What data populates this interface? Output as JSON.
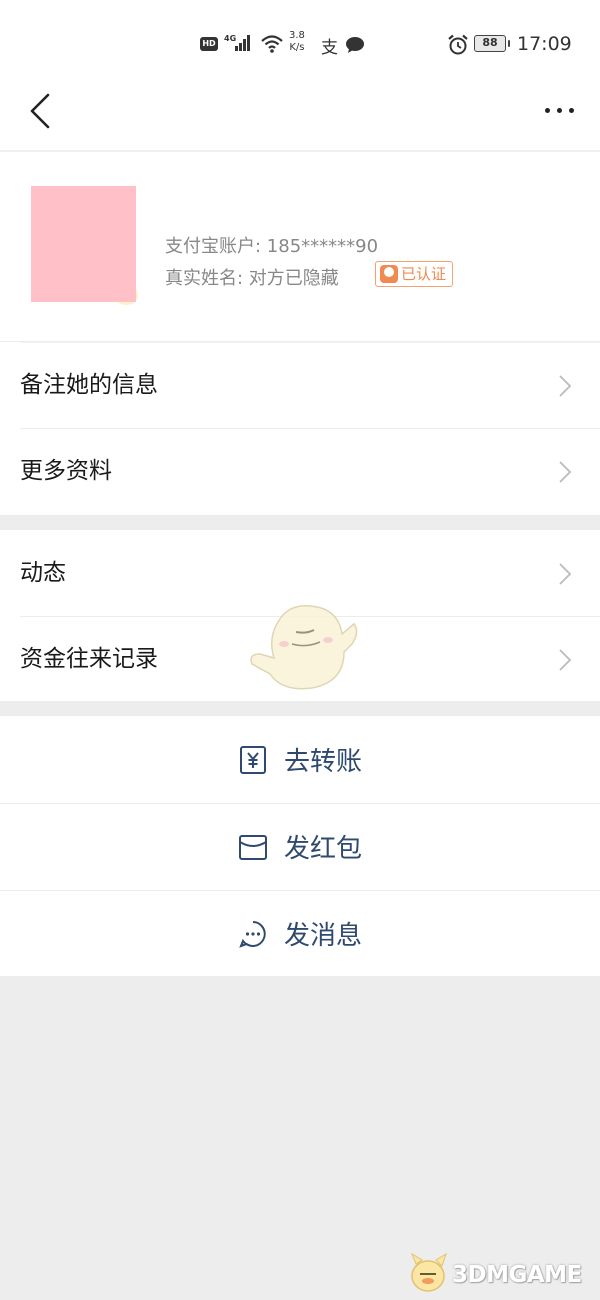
{
  "status_bar": {
    "hd": "HD",
    "network": "4G",
    "speed_value": "3.8",
    "speed_unit": "K/s",
    "alipay_glyph": "支",
    "battery": "88",
    "time": "17:09"
  },
  "nav": {
    "back_icon": "chevron-left-icon",
    "more_icon": "more-dots-icon"
  },
  "profile": {
    "account_line": "支付宝账户: 185******90",
    "name_line": "真实姓名: 对方已隐藏",
    "verified_label": "已认证",
    "avatar_color": "#ffc0c8"
  },
  "list_group_1": [
    {
      "label": "备注她的信息"
    },
    {
      "label": "更多资料"
    }
  ],
  "list_group_2": [
    {
      "label": "动态"
    },
    {
      "label": "资金往来记录"
    }
  ],
  "actions": [
    {
      "label": "去转账",
      "icon": "transfer-yuan-icon"
    },
    {
      "label": "发红包",
      "icon": "red-packet-icon"
    },
    {
      "label": "发消息",
      "icon": "chat-bubble-icon"
    }
  ],
  "watermark": {
    "text": "3DMGAME"
  },
  "colors": {
    "accent_text": "#2f4a6e",
    "verified": "#f08a50",
    "page_bg": "#ededed"
  }
}
